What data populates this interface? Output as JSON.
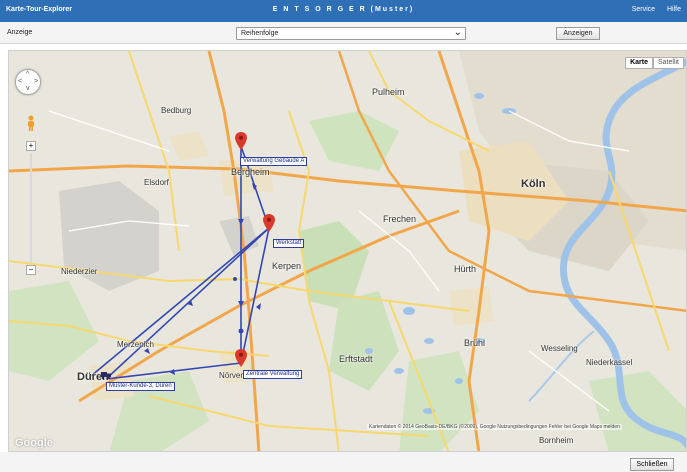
{
  "window": {
    "title": "Karte-Tour-Explorer",
    "center_title": "E N T S O R G E R (Muster)",
    "menu": [
      "Service",
      "Hilfe"
    ]
  },
  "toolbar": {
    "label": "Anzeige",
    "select_value": "Reihenfolge",
    "show_button": "Anzeigen"
  },
  "map": {
    "type_active": "Karte",
    "type_inactive": "Satellit",
    "places": [
      {
        "name": "Pulheim",
        "cls": "med"
      },
      {
        "name": "Köln",
        "cls": "big"
      },
      {
        "name": "Bergheim",
        "cls": "med"
      },
      {
        "name": "Elsdorf",
        "cls": ""
      },
      {
        "name": "Frechen",
        "cls": "med"
      },
      {
        "name": "Kerpen",
        "cls": "med"
      },
      {
        "name": "Hürth",
        "cls": "med"
      },
      {
        "name": "Niederzier",
        "cls": ""
      },
      {
        "name": "Merzenich",
        "cls": ""
      },
      {
        "name": "Erftstadt",
        "cls": "med"
      },
      {
        "name": "Brühl",
        "cls": "med"
      },
      {
        "name": "Wesseling",
        "cls": ""
      },
      {
        "name": "Niederkassel",
        "cls": ""
      },
      {
        "name": "Bornheim",
        "cls": ""
      },
      {
        "name": "Bedburg",
        "cls": ""
      },
      {
        "name": "Düren",
        "cls": "big"
      },
      {
        "name": "Nörvenich",
        "cls": ""
      }
    ],
    "stops": [
      {
        "label": "Verwaltung Gebäude A"
      },
      {
        "label": "Werkstatt"
      },
      {
        "label": "Zentrale Verwaltung"
      },
      {
        "label": "Muster-Kunde-3, Düren"
      }
    ],
    "copyright": "Kartendaten © 2014 GeoBasis-DE/BKG (©2009), Google   Nutzungsbedingungen   Fehler bei Google Maps melden",
    "logo": "Google"
  },
  "footer": {
    "close_button": "Schließen"
  },
  "colors": {
    "titlebar": "#2f6fb6",
    "route": "#3347b3",
    "pin": "#d93a2b"
  }
}
